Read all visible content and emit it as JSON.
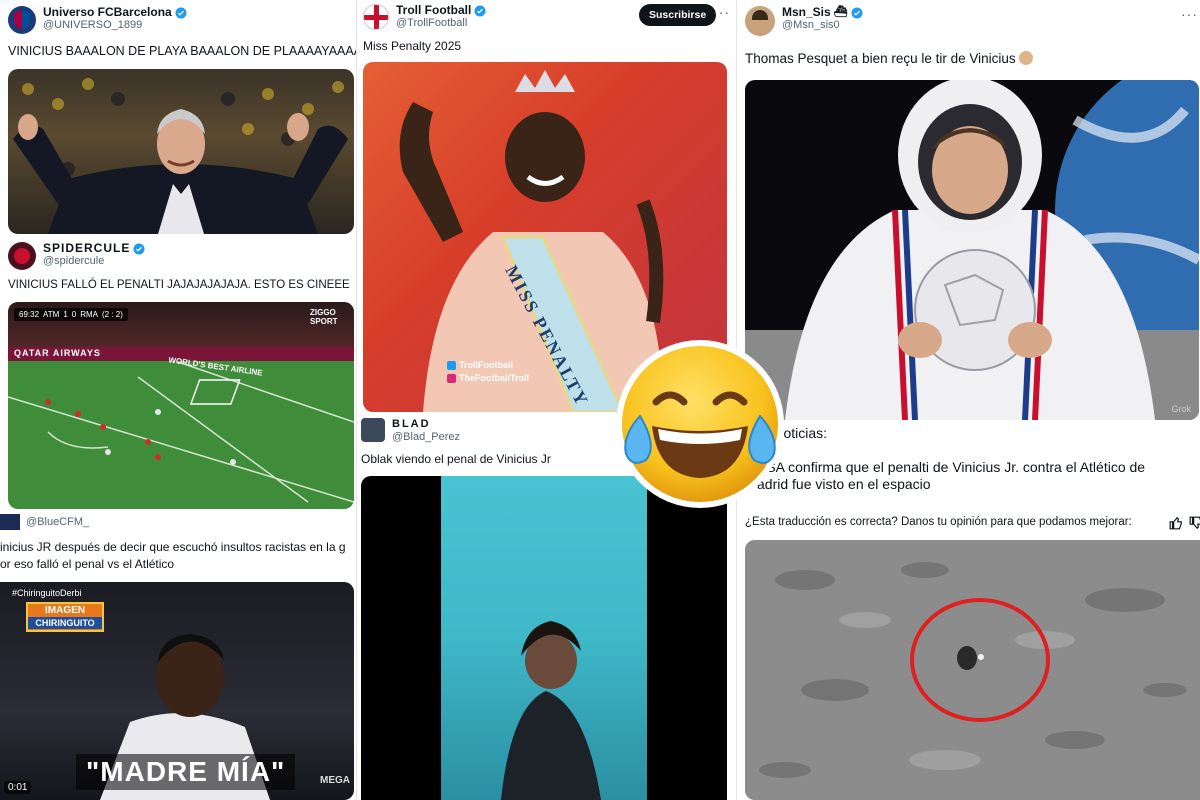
{
  "col1": {
    "tweet1": {
      "name": "Universo FCBarcelona",
      "handle": "@UNIVERSO_1899",
      "text": "VINICIUS BAAALON DE PLAYA BAAALON DE PLAAAAYAAAA"
    },
    "tweet2": {
      "name": "SPIDERCULE",
      "handle": "@spidercule",
      "text": "VINICIUS FALLÓ EL PENALTI JAJAJAJAJAJA. ESTO ES CINEEE",
      "scoreboard": {
        "time": "69:32",
        "home": "ATM",
        "home_score": "1",
        "away_score": "0",
        "away": "RMA",
        "aggregate": "(2 : 2)"
      },
      "broadcaster": "ZIGGO SPORT",
      "ad_left": "QATAR AIRWAYS",
      "ad_center": "WORLD'S BEST AIRLINE"
    },
    "tweet3": {
      "handle": "@BlueCFM_",
      "text_line1": "inicius JR después de decir que escuchó insultos racistas en la g",
      "text_line2": "or eso falló el penal vs el Atlético",
      "hashtag": "#ChiringuitoDerbi",
      "badge_top": "IMAGEN",
      "badge_bottom": "CHIRINGUITO",
      "caption": "\"MADRE MÍA\"",
      "time": "0:01",
      "watermark": "MEGA"
    }
  },
  "col2": {
    "tweet1": {
      "name": "Troll Football",
      "handle": "@TrollFootball",
      "follow_label": "Suscribirse",
      "more": "···",
      "text": "Miss Penalty 2025",
      "sash": "MISS PENALTY",
      "wm1": "TrollFootball",
      "wm2": "TheFootballTroll"
    },
    "tweet2": {
      "name": "BLAD",
      "handle": "@Blad_Perez",
      "text": "Oblak viendo el penal de Vinicius Jr"
    }
  },
  "col3": {
    "tweet1": {
      "name": "Msn_Sis",
      "handle": "@Msn_sis0",
      "more": "···",
      "text": "Thomas Pesquet a bien reçu le tir de Vinicius"
    },
    "tweet2": {
      "line1": "as noticias:",
      "line2": "ASA confirma que el penalti de Vinicius Jr. contra el Atlético de",
      "line3": "adrid fue visto en el espacio",
      "translate_prompt": "¿Esta traducción es correcta? Danos tu opinión para que podamos mejorar:",
      "image_tag": "Grok"
    }
  },
  "colors": {
    "verified": "#1d9bf0",
    "pitch": "#3f8d3a",
    "sky_blue": "#3fb8c8",
    "red_circle": "#e02020"
  }
}
